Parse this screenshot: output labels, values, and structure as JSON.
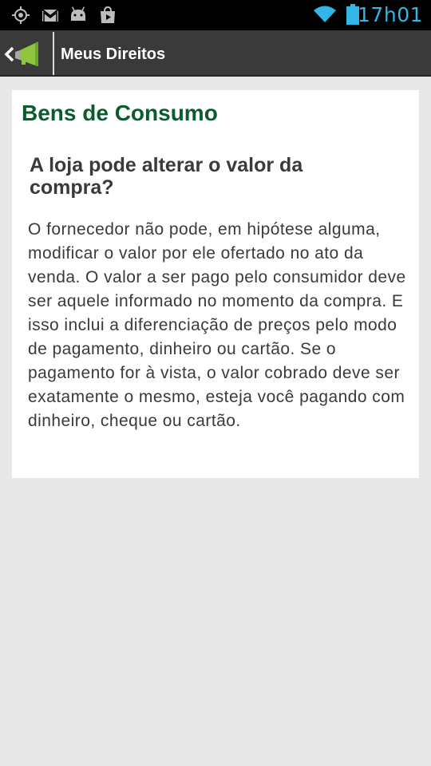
{
  "status_bar": {
    "time": "17h01",
    "left_icons": [
      "gps-icon",
      "gmail-icon",
      "android-debug-icon",
      "play-store-icon"
    ],
    "right_icons": [
      "wifi-icon",
      "battery-icon"
    ],
    "accent_color": "#33b5e5"
  },
  "action_bar": {
    "title": "Meus Direitos",
    "app_icon": "megaphone-icon",
    "up_icon": "chevron-left-icon"
  },
  "content": {
    "section_title": "Bens de Consumo",
    "question": "A loja pode alterar o valor da compra?",
    "answer": "O fornecedor não pode, em hipótese alguma, modificar o valor por ele ofertado no ato da venda. O valor a ser pago pelo consumidor deve ser aquele informado no momento da compra. E isso inclui a diferenciação de preços pelo modo de pagamento, dinheiro ou cartão. Se o pagamento for à vista, o valor cobrado deve ser exatamente o mesmo, esteja você pagando com dinheiro, cheque ou cartão.",
    "title_color": "#0b5c2b"
  }
}
